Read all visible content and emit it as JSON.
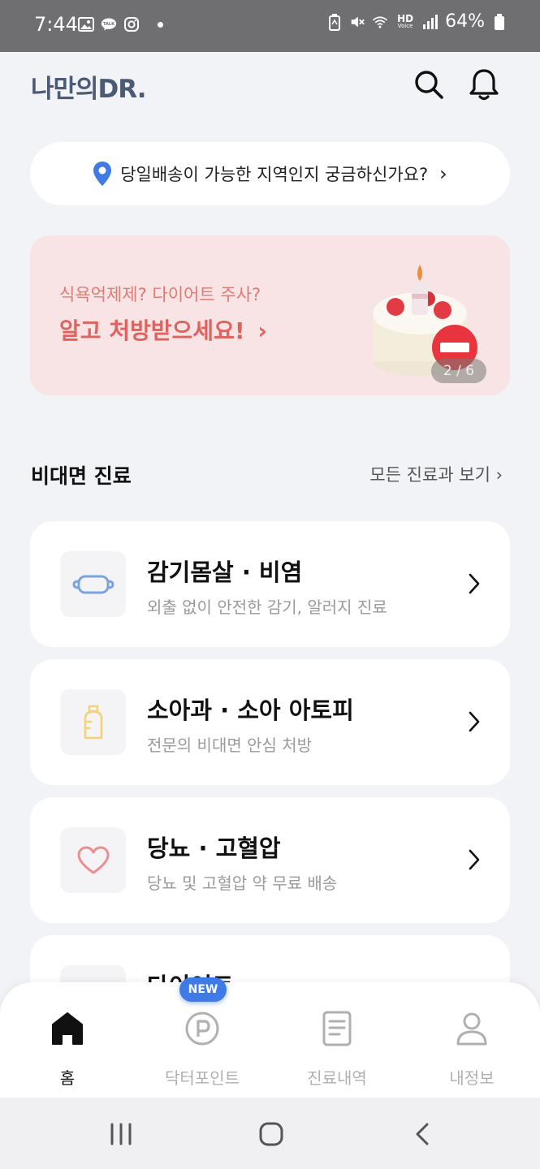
{
  "status_bar": {
    "time": "7:44",
    "battery": "64%",
    "hd_label": "HD",
    "voice_label": "Voice",
    "talk_label": "TALK"
  },
  "header": {
    "logo": "나만의DR.",
    "search_icon": "search-icon",
    "bell_icon": "bell-icon"
  },
  "location": {
    "text": "당일배송이 가능한 지역인지 궁금하신가요?",
    "chevron": "›"
  },
  "banner": {
    "subtitle": "식욕억제제? 다이어트 주사?",
    "title": "알고 처방받으세요!",
    "chevron": "›",
    "counter": "2 / 6"
  },
  "section": {
    "title": "비대면 진료",
    "link": "모든 진료과 보기 ›"
  },
  "cards": [
    {
      "title": "감기몸살 · 비염",
      "desc": "외출 없이 안전한 감기, 알러지 진료",
      "icon": "mask-icon"
    },
    {
      "title": "소아과 · 소아 아토피",
      "desc": "전문의 비대면 안심 처방",
      "icon": "baby-bottle-icon"
    },
    {
      "title": "당뇨 · 고혈압",
      "desc": "당뇨 및 고혈압 약 무료 배송",
      "icon": "heart-icon"
    },
    {
      "title": "다이어트",
      "desc": "",
      "icon": "diet-icon"
    }
  ],
  "bottom_nav": {
    "new_badge": "NEW",
    "items": [
      {
        "label": "홈",
        "icon": "home-icon"
      },
      {
        "label": "닥터포인트",
        "icon": "point-icon"
      },
      {
        "label": "진료내역",
        "icon": "document-icon"
      },
      {
        "label": "내정보",
        "icon": "profile-icon"
      }
    ]
  },
  "colors": {
    "background": "#f2f3f7",
    "logo": "#4a5b73",
    "banner_bg": "#f8e4e4",
    "banner_text": "#e0625e",
    "accent_blue": "#3f7be6"
  }
}
